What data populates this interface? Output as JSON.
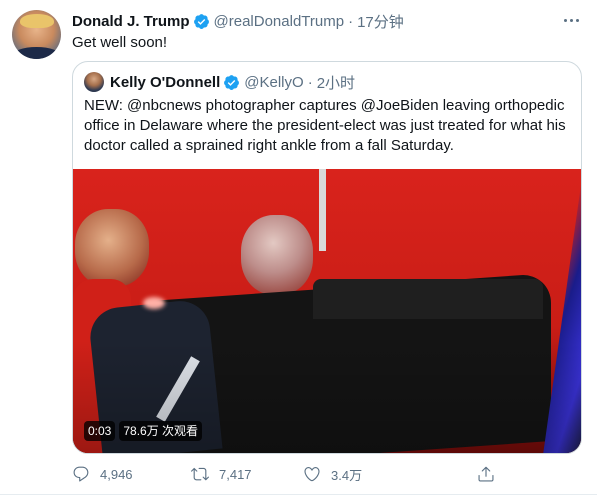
{
  "tweet": {
    "author_name": "Donald J. Trump",
    "author_handle": "@realDonaldTrump",
    "separator": "·",
    "time": "17分钟",
    "text": "Get well soon!",
    "avatar_icon": "profile-avatar",
    "verified_icon": "verified-badge-icon",
    "more_icon": "more-options-icon"
  },
  "quoted": {
    "author_name": "Kelly O'Donnell",
    "author_handle": "@KellyO",
    "separator": "·",
    "time": "2小时",
    "text": "NEW:  @nbcnews photographer captures @JoeBiden leaving orthopedic office in Delaware where the president-elect was just treated for what his doctor called a sprained right ankle from a fall Saturday.",
    "video": {
      "duration": "0:03",
      "views": "78.6万 次观看"
    }
  },
  "actions": {
    "reply_count": "4,946",
    "retweet_count": "7,417",
    "like_count": "3.4万",
    "icons": [
      "reply-icon",
      "retweet-icon",
      "like-icon",
      "share-icon"
    ]
  },
  "colors": {
    "accent": "#1da1f2",
    "secondary_text": "#5b7083",
    "primary_text": "#0f1419",
    "border": "#cfd9de"
  }
}
